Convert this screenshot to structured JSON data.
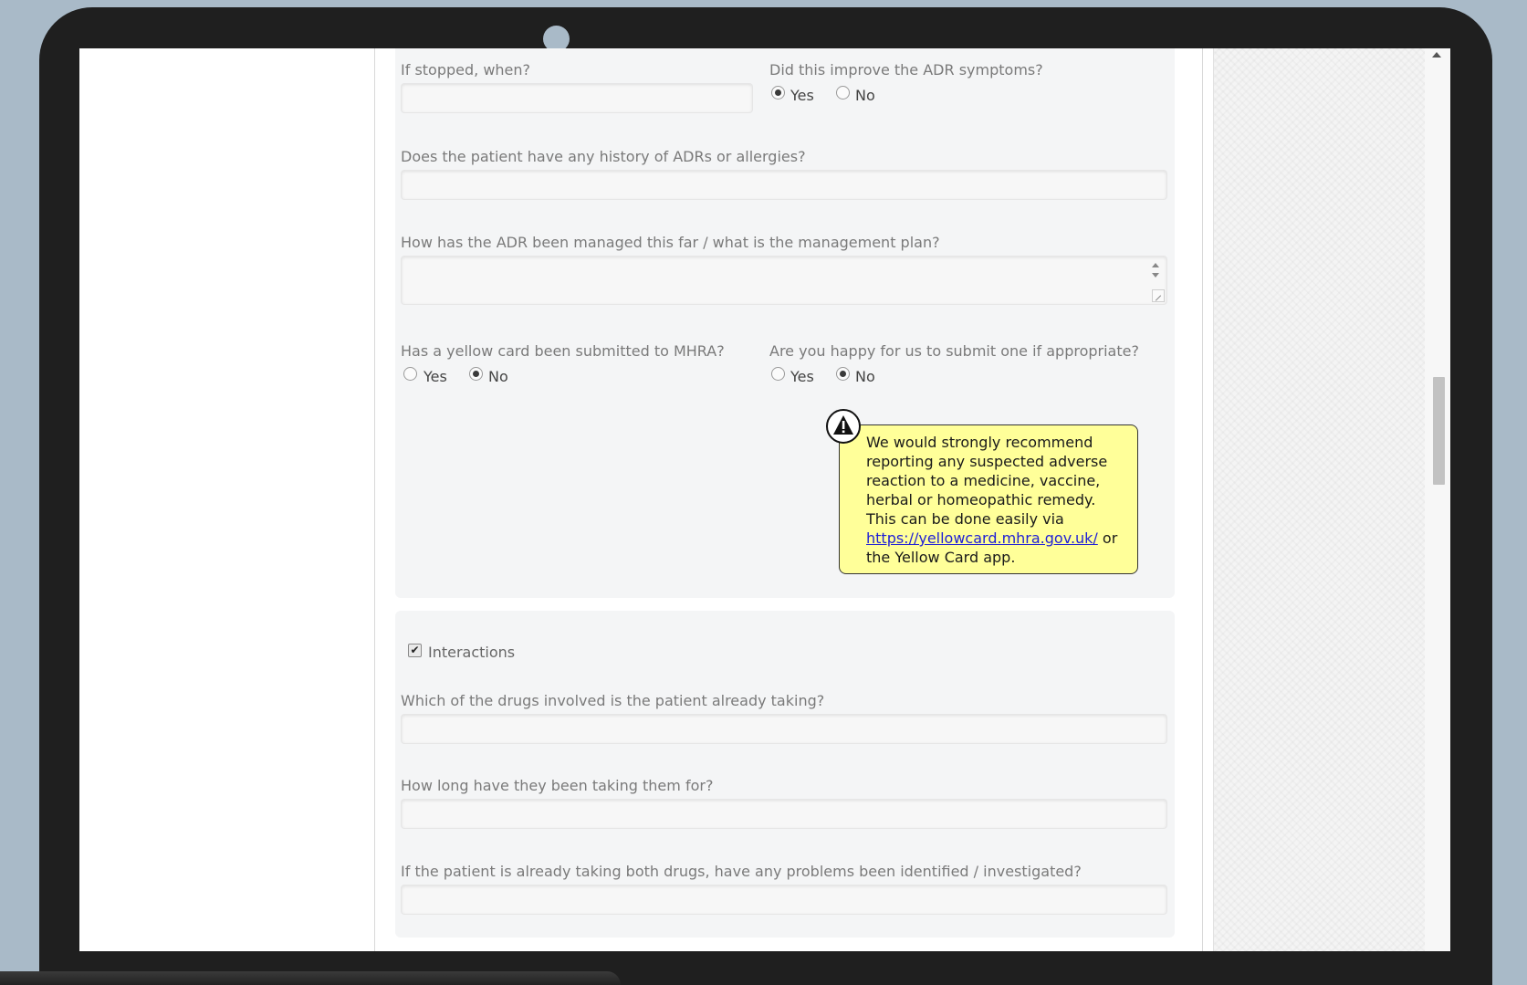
{
  "form": {
    "adr": {
      "stopped_when_label": "If stopped, when?",
      "stopped_when_value": "",
      "improve_label": "Did this improve the ADR symptoms?",
      "improve_options": [
        "Yes",
        "No"
      ],
      "improve_selected": "Yes",
      "history_label": "Does the patient have any history of ADRs or allergies?",
      "history_value": "",
      "management_label": "How has the ADR been managed this far / what is the management plan?",
      "management_value": "",
      "yellow_card_label": "Has a yellow card been submitted to MHRA?",
      "yellow_card_options": [
        "Yes",
        "No"
      ],
      "yellow_card_selected": "No",
      "submit_label": "Are you happy for us to submit one if appropriate?",
      "submit_options": [
        "Yes",
        "No"
      ],
      "submit_selected": "No",
      "notice": {
        "text": "We would strongly recommend reporting any suspected adverse reaction to a medicine, vaccine, herbal or homeopathic remedy. This can be done easily via",
        "link": "https://yellowcard.mhra.gov.uk/",
        "suffix": "or the Yellow Card app."
      }
    },
    "interactions": {
      "checkbox_label": "Interactions",
      "checked": true,
      "drugs_label": "Which of the drugs involved is the patient already taking?",
      "drugs_value": "",
      "duration_label": "How long have they been taking them for?",
      "duration_value": "",
      "problems_label": "If the patient is already taking both drugs, have any problems been identified / investigated?",
      "problems_value": ""
    }
  },
  "colors": {
    "background": "#a9bac8",
    "laptop_bezel": "#1f1f1f",
    "panel": "#f4f5f6",
    "notice_bg": "#ffff99",
    "link": "#1f1fd6"
  }
}
